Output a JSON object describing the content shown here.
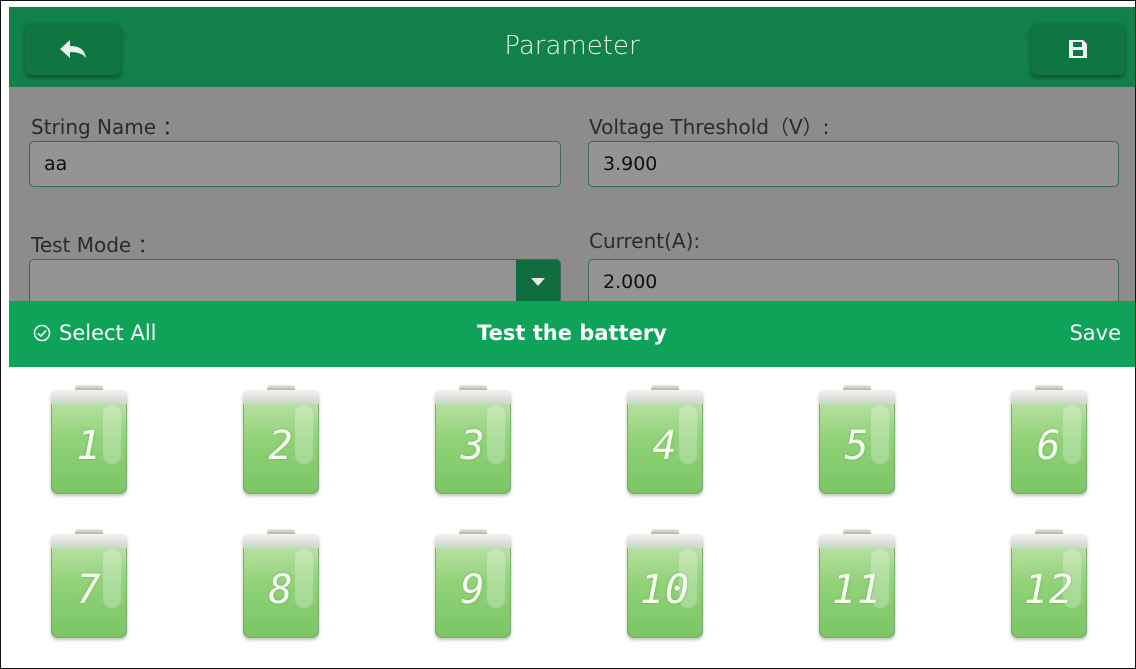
{
  "header": {
    "title": "Parameter",
    "back_icon": "back-arrow-icon",
    "save_icon": "floppy-disk-icon"
  },
  "form": {
    "string_name": {
      "label": "String Name ：",
      "value": "aa"
    },
    "voltage_threshold": {
      "label": "Voltage Threshold（V）:",
      "value": "3.900"
    },
    "test_mode": {
      "label": "Test Mode ：",
      "value": ""
    },
    "current": {
      "label": "Current(A):",
      "value": "2.000"
    }
  },
  "action_bar": {
    "select_all": "Select All",
    "title": "Test the battery",
    "save": "Save"
  },
  "batteries": [
    "1",
    "2",
    "3",
    "4",
    "5",
    "6",
    "7",
    "8",
    "9",
    "10",
    "11",
    "12"
  ],
  "colors": {
    "header": "#12804a",
    "action_bar": "#0fa35a",
    "battery": "#8fd178"
  }
}
